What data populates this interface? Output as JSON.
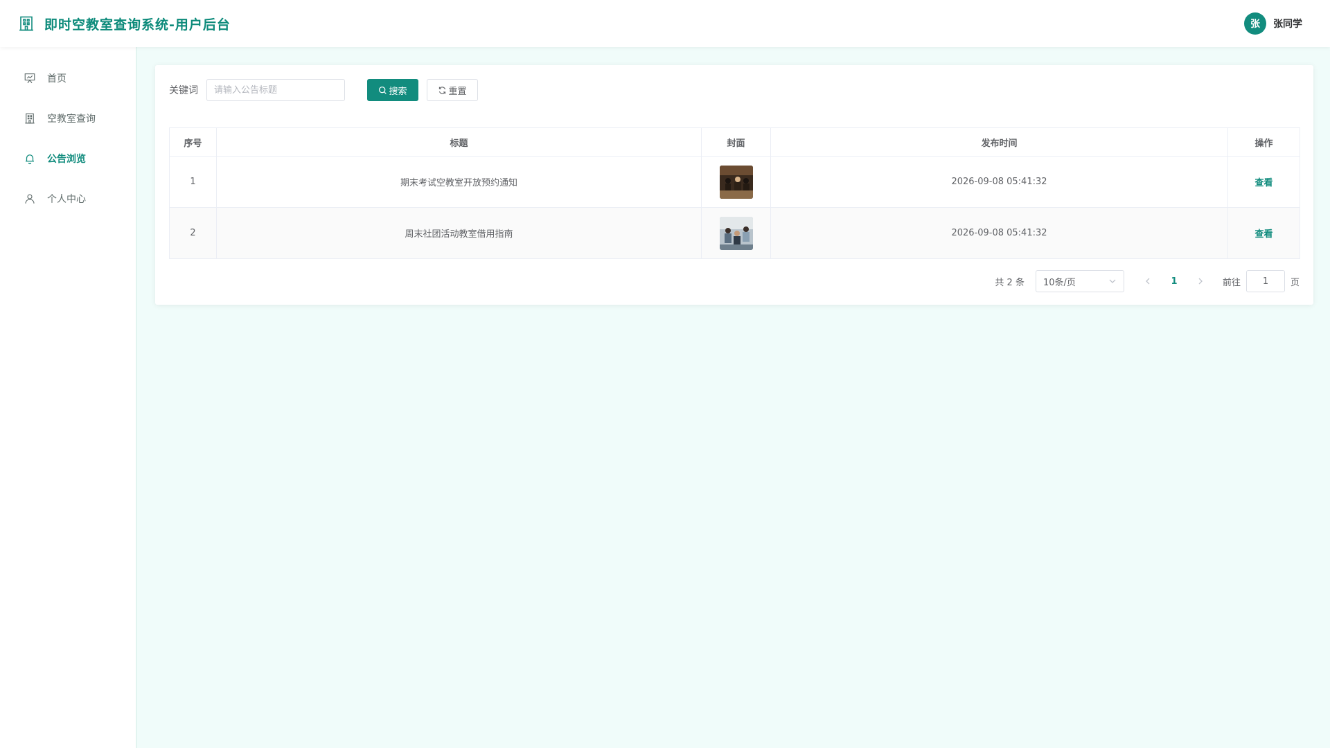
{
  "app": {
    "title": "即时空教室查询系统-用户后台"
  },
  "user": {
    "avatar_text": "张",
    "name": "张同学"
  },
  "sidebar": {
    "items": [
      {
        "label": "首页",
        "icon": "presentation-icon",
        "active": false
      },
      {
        "label": "空教室查询",
        "icon": "building-icon",
        "active": false
      },
      {
        "label": "公告浏览",
        "icon": "bell-icon",
        "active": true
      },
      {
        "label": "个人中心",
        "icon": "user-icon",
        "active": false
      }
    ]
  },
  "search": {
    "label": "关键词",
    "placeholder": "请输入公告标题",
    "value": "",
    "search_label": "搜索",
    "reset_label": "重置"
  },
  "table": {
    "headers": [
      "序号",
      "标题",
      "封面",
      "发布时间",
      "操作"
    ],
    "rows": [
      {
        "index": "1",
        "title": "期末考试空教室开放预约通知",
        "published": "2026-09-08 05:41:32",
        "action": "查看"
      },
      {
        "index": "2",
        "title": "周末社团活动教室借用指南",
        "published": "2026-09-08 05:41:32",
        "action": "查看"
      }
    ]
  },
  "pagination": {
    "total_text": "共 2 条",
    "page_size": "10条/页",
    "current_page": "1",
    "goto_label": "前往",
    "goto_value": "1",
    "page_unit": "页"
  },
  "colors": {
    "accent": "#128c7e",
    "background": "#f0fcfa"
  }
}
